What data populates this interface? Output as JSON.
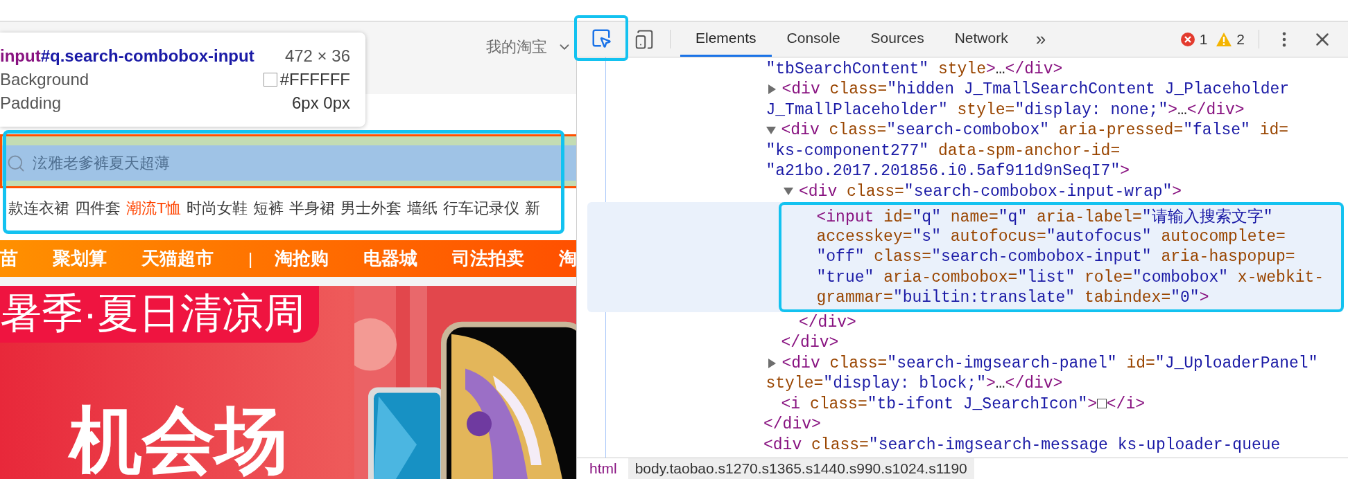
{
  "page": {
    "header": {
      "account_menu": "我的淘宝"
    },
    "inspect_tooltip": {
      "tag": "input",
      "selector": "#q.search-combobox-input",
      "size": "472 × 36",
      "rows": [
        {
          "kind": "color",
          "label": "Background",
          "value": "#FFFFFF"
        },
        {
          "kind": "text",
          "label": "Padding",
          "value": "6px 0px"
        }
      ]
    },
    "search": {
      "placeholder": "泫雅老爹裤夏天超薄",
      "annotated": true
    },
    "hot_words": [
      {
        "text": "款连衣裙",
        "hot": false
      },
      {
        "text": "四件套",
        "hot": false
      },
      {
        "text": "潮流T恤",
        "hot": true
      },
      {
        "text": "时尚女鞋",
        "hot": false
      },
      {
        "text": "短裤",
        "hot": false
      },
      {
        "text": "半身裙",
        "hot": false
      },
      {
        "text": "男士外套",
        "hot": false
      },
      {
        "text": "墙纸",
        "hot": false
      },
      {
        "text": "行车记录仪",
        "hot": false
      },
      {
        "text": "新",
        "hot": false
      }
    ],
    "nav": [
      {
        "kind": "link",
        "label": "苗"
      },
      {
        "kind": "link",
        "label": "聚划算"
      },
      {
        "kind": "link",
        "label": "天猫超市"
      },
      {
        "kind": "separator",
        "label": "|"
      },
      {
        "kind": "link",
        "label": "淘抢购"
      },
      {
        "kind": "link",
        "label": "电器城"
      },
      {
        "kind": "link",
        "label": "司法拍卖"
      },
      {
        "kind": "link",
        "label": "淘"
      }
    ],
    "banner": {
      "tag": "暑季·夏日清凉周",
      "headline": "机会场"
    }
  },
  "devtools": {
    "inspect_button": {
      "active": true,
      "annotated": true
    },
    "tabs": [
      {
        "label": "Elements",
        "selected": true
      },
      {
        "label": "Console",
        "selected": false
      },
      {
        "label": "Sources",
        "selected": false
      },
      {
        "label": "Network",
        "selected": false
      }
    ],
    "overflow": "»",
    "errors": "1",
    "warnings": "2",
    "dom_tree": [
      {
        "kind": "container",
        "children": [
          {
            "kind": "fragment",
            "lines": [
              [
                {
                  "kind": "val",
                  "text": "\"tbSearchContent\""
                },
                {
                  "kind": "attr",
                  "text": " style"
                },
                {
                  "kind": "tag",
                  "text": ">"
                },
                {
                  "kind": "text",
                  "text": "…"
                },
                {
                  "kind": "tag",
                  "text": "</div>"
                }
              ]
            ]
          },
          {
            "kind": "element",
            "expanded": false,
            "lines": [
              [
                {
                  "kind": "tag",
                  "text": "<div"
                },
                {
                  "kind": "attr",
                  "text": " class="
                },
                {
                  "kind": "val",
                  "text": "\"hidden J_TmallSearchContent J_Placeholder"
                }
              ],
              [
                {
                  "kind": "val",
                  "text": "J_TmallPlaceholder\""
                },
                {
                  "kind": "attr",
                  "text": " style="
                },
                {
                  "kind": "val",
                  "text": "\"display: none;\""
                },
                {
                  "kind": "tag",
                  "text": ">"
                },
                {
                  "kind": "text",
                  "text": "…"
                },
                {
                  "kind": "tag",
                  "text": "</div>"
                }
              ]
            ]
          },
          {
            "kind": "element",
            "expanded": true,
            "lines": [
              [
                {
                  "kind": "tag",
                  "text": "<div"
                },
                {
                  "kind": "attr",
                  "text": " class="
                },
                {
                  "kind": "val",
                  "text": "\"search-combobox\""
                },
                {
                  "kind": "attr",
                  "text": " aria-pressed="
                },
                {
                  "kind": "val",
                  "text": "\"false\""
                },
                {
                  "kind": "attr",
                  "text": " id="
                }
              ],
              [
                {
                  "kind": "val",
                  "text": "\"ks-component277\""
                },
                {
                  "kind": "attr",
                  "text": " data-spm-anchor-id="
                }
              ],
              [
                {
                  "kind": "val",
                  "text": "\"a21bo.2017.201856.i0.5af911d9nSeqI7\""
                },
                {
                  "kind": "tag",
                  "text": ">"
                }
              ]
            ],
            "children": [
              {
                "kind": "element",
                "expanded": true,
                "lines": [
                  [
                    {
                      "kind": "tag",
                      "text": "<div"
                    },
                    {
                      "kind": "attr",
                      "text": " class="
                    },
                    {
                      "kind": "val",
                      "text": "\"search-combobox-input-wrap\""
                    },
                    {
                      "kind": "tag",
                      "text": ">"
                    }
                  ]
                ],
                "children": [
                  {
                    "kind": "leaf",
                    "selected": true,
                    "annotated": true,
                    "lines": [
                      [
                        {
                          "kind": "tag",
                          "text": "<input"
                        },
                        {
                          "kind": "attr",
                          "text": " id="
                        },
                        {
                          "kind": "val",
                          "text": "\"q\""
                        },
                        {
                          "kind": "attr",
                          "text": " name="
                        },
                        {
                          "kind": "val",
                          "text": "\"q\""
                        },
                        {
                          "kind": "attr",
                          "text": " aria-label="
                        },
                        {
                          "kind": "val",
                          "text": "\"请输入搜索文字\""
                        }
                      ],
                      [
                        {
                          "kind": "attr",
                          "text": "accesskey="
                        },
                        {
                          "kind": "val",
                          "text": "\"s\""
                        },
                        {
                          "kind": "attr",
                          "text": " autofocus="
                        },
                        {
                          "kind": "val",
                          "text": "\"autofocus\""
                        },
                        {
                          "kind": "attr",
                          "text": " autocomplete="
                        }
                      ],
                      [
                        {
                          "kind": "val",
                          "text": "\"off\""
                        },
                        {
                          "kind": "attr",
                          "text": " class="
                        },
                        {
                          "kind": "val",
                          "text": "\"search-combobox-input\""
                        },
                        {
                          "kind": "attr",
                          "text": " aria-haspopup="
                        }
                      ],
                      [
                        {
                          "kind": "val",
                          "text": "\"true\""
                        },
                        {
                          "kind": "attr",
                          "text": " aria-combobox="
                        },
                        {
                          "kind": "val",
                          "text": "\"list\""
                        },
                        {
                          "kind": "attr",
                          "text": " role="
                        },
                        {
                          "kind": "val",
                          "text": "\"combobox\""
                        },
                        {
                          "kind": "attr",
                          "text": " x-webkit-"
                        }
                      ],
                      [
                        {
                          "kind": "attr",
                          "text": "grammar="
                        },
                        {
                          "kind": "val",
                          "text": "\"builtin:translate\""
                        },
                        {
                          "kind": "attr",
                          "text": " tabindex="
                        },
                        {
                          "kind": "val",
                          "text": "\"0\""
                        },
                        {
                          "kind": "tag",
                          "text": ">"
                        }
                      ]
                    ]
                  }
                ],
                "closing": [
                  {
                    "kind": "tag",
                    "text": "</div>"
                  }
                ]
              }
            ],
            "closing": [
              {
                "kind": "tag",
                "text": "</div>"
              }
            ]
          },
          {
            "kind": "element",
            "expanded": false,
            "lines": [
              [
                {
                  "kind": "tag",
                  "text": "<div"
                },
                {
                  "kind": "attr",
                  "text": " class="
                },
                {
                  "kind": "val",
                  "text": "\"search-imgsearch-panel\""
                },
                {
                  "kind": "attr",
                  "text": " id="
                },
                {
                  "kind": "val",
                  "text": "\"J_UploaderPanel\""
                }
              ],
              [
                {
                  "kind": "attr",
                  "text": "style="
                },
                {
                  "kind": "val",
                  "text": "\"display: block;\""
                },
                {
                  "kind": "tag",
                  "text": ">"
                },
                {
                  "kind": "text",
                  "text": "…"
                },
                {
                  "kind": "tag",
                  "text": "</div>"
                }
              ]
            ]
          },
          {
            "kind": "leaf",
            "selected": false,
            "lines": [
              [
                {
                  "kind": "tag",
                  "text": "<i"
                },
                {
                  "kind": "attr",
                  "text": " class="
                },
                {
                  "kind": "val",
                  "text": "\"tb-ifont J_SearchIcon\""
                },
                {
                  "kind": "tag",
                  "text": ">"
                },
                {
                  "kind": "text",
                  "text": "□"
                },
                {
                  "kind": "tag",
                  "text": "</i>"
                }
              ]
            ]
          }
        ],
        "closing": [
          {
            "kind": "tag",
            "text": "</div>"
          }
        ]
      },
      {
        "kind": "leaf",
        "selected": false,
        "lines": [
          [
            {
              "kind": "tag",
              "text": "<div"
            },
            {
              "kind": "attr",
              "text": " class="
            },
            {
              "kind": "val",
              "text": "\"search-imgsearch-message ks-uploader-queue"
            }
          ]
        ]
      }
    ],
    "breadcrumbs": [
      {
        "label": "html",
        "selected": false
      },
      {
        "label": "body.taobao.s1270.s1365.s1440.s990.s1024.s1190",
        "selected": true
      }
    ]
  }
}
